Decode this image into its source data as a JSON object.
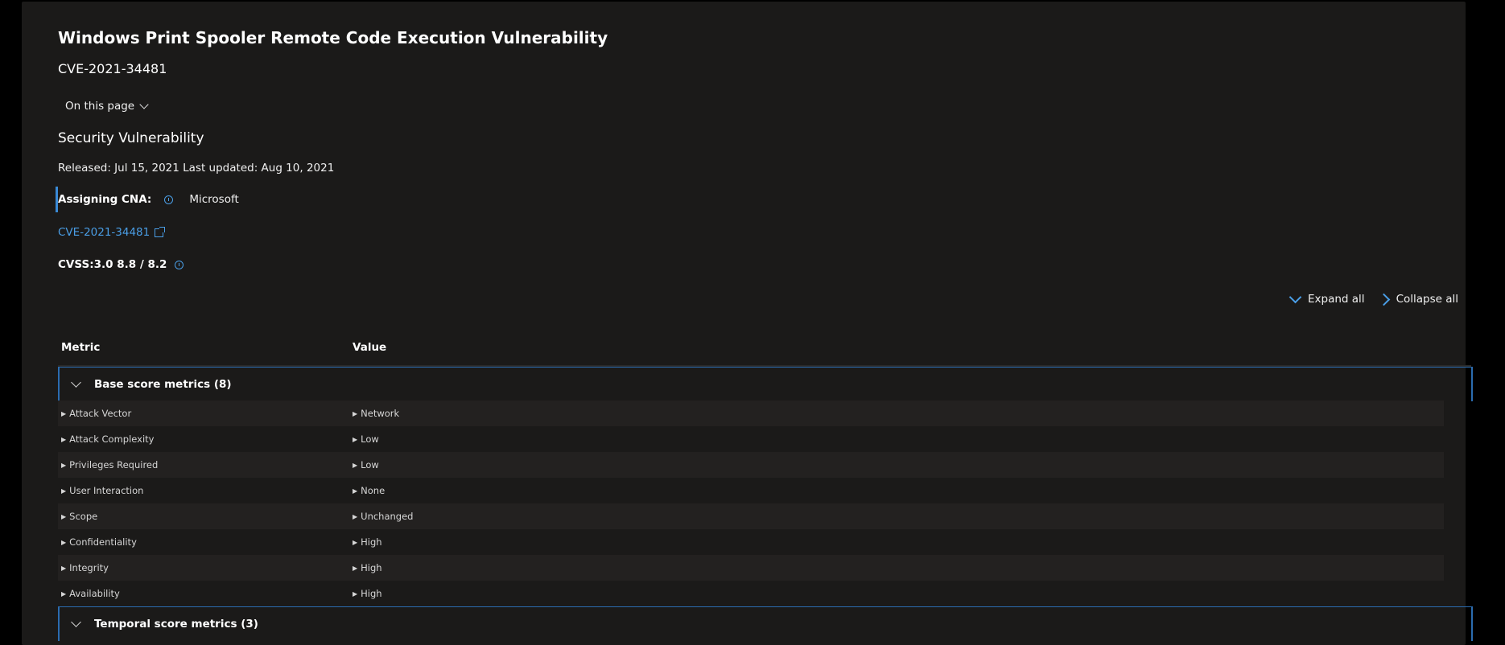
{
  "page": {
    "title": "Windows Print Spooler Remote Code Execution Vulnerability",
    "cve_id": "CVE-2021-34481",
    "on_this_page": "On this page",
    "section_title": "Security Vulnerability",
    "dates": "Released: Jul 15, 2021 Last updated: Aug 10, 2021",
    "assigning_cna_label": "Assigning CNA:",
    "assigning_cna_value": "Microsoft",
    "cve_link": "CVE-2021-34481",
    "cvss": "CVSS:3.0 8.8 / 8.2"
  },
  "controls": {
    "expand_all": "Expand all",
    "collapse_all": "Collapse all"
  },
  "table": {
    "headers": [
      "Metric",
      "Value"
    ],
    "groups": [
      {
        "label": "Base score metrics (8)"
      },
      {
        "label": "Temporal score metrics (3)"
      }
    ],
    "rows": [
      {
        "metric": "Attack Vector",
        "value": "Network"
      },
      {
        "metric": "Attack Complexity",
        "value": "Low"
      },
      {
        "metric": "Privileges Required",
        "value": "Low"
      },
      {
        "metric": "User Interaction",
        "value": "None"
      },
      {
        "metric": "Scope",
        "value": "Unchanged"
      },
      {
        "metric": "Confidentiality",
        "value": "High"
      },
      {
        "metric": "Integrity",
        "value": "High"
      },
      {
        "metric": "Availability",
        "value": "High"
      }
    ]
  },
  "colors": {
    "accent": "#4a9ee6",
    "panel_bg": "#1b1a19",
    "row_alt_bg": "#232120"
  }
}
